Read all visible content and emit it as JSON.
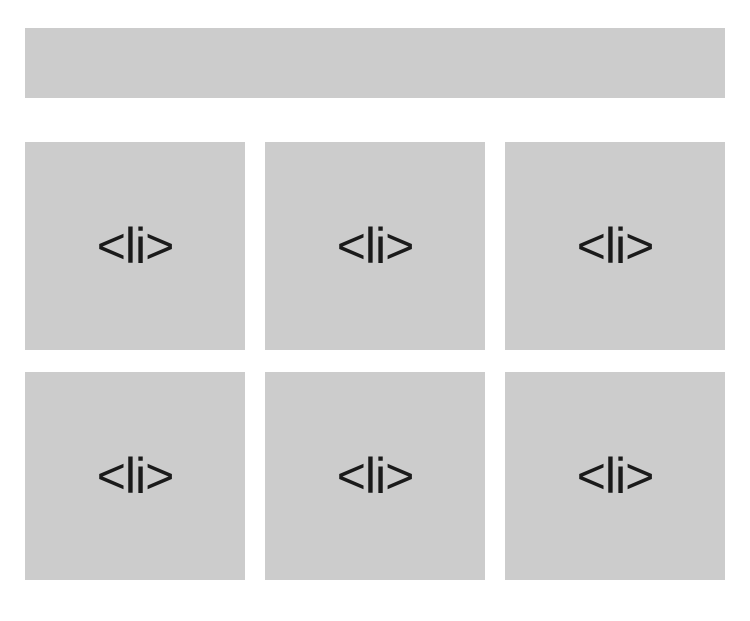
{
  "tiles": [
    {
      "label": "<li>"
    },
    {
      "label": "<li>"
    },
    {
      "label": "<li>"
    },
    {
      "label": "<li>"
    },
    {
      "label": "<li>"
    },
    {
      "label": "<li>"
    }
  ]
}
